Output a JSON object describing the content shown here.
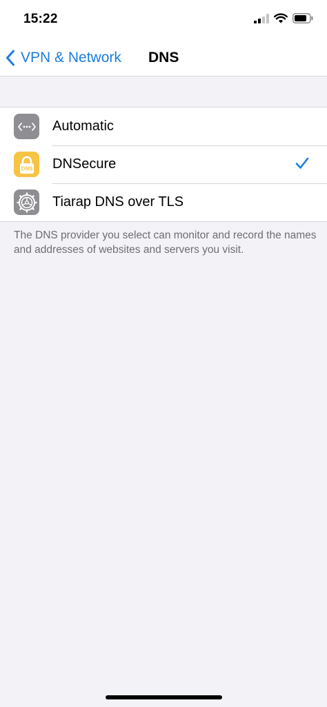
{
  "status_bar": {
    "time": "15:22"
  },
  "nav": {
    "back_label": "VPN & Network",
    "title": "DNS"
  },
  "options": [
    {
      "label": "Automatic",
      "icon": "dots-arrows-icon",
      "selected": false
    },
    {
      "label": "DNSecure",
      "icon": "dns-lock-icon",
      "icon_text": "DNS",
      "selected": true
    },
    {
      "label": "Tiarap DNS over TLS",
      "icon": "gear-icon",
      "selected": false
    }
  ],
  "footer": {
    "text": "The DNS provider you select can monitor and record the names and addresses of websites and servers you visit."
  },
  "colors": {
    "accent": "#1a7ce0",
    "background": "#f2f2f7",
    "gray_icon": "#8e8e93",
    "yellow_icon": "#f6c445"
  }
}
